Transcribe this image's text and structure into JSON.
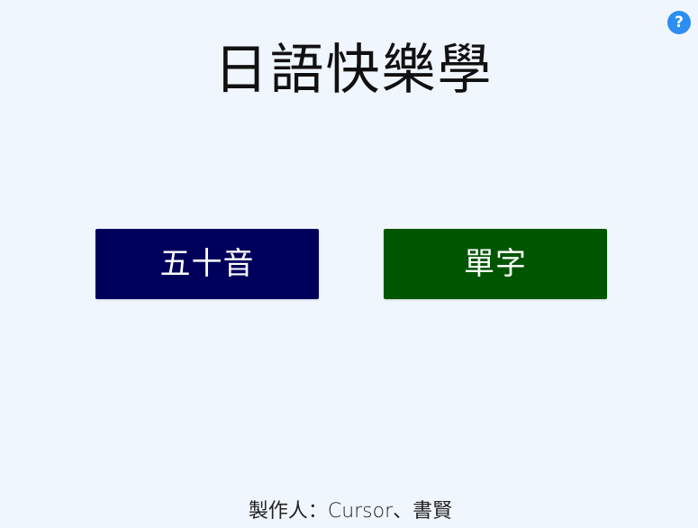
{
  "app": {
    "title": "日語快樂學"
  },
  "help": {
    "label": "?",
    "icon": "help-icon",
    "color": "#2b8ef0"
  },
  "menu": {
    "kana_label": "五十音",
    "kana_color": "#00005c",
    "vocab_label": "單字",
    "vocab_color": "#005600"
  },
  "footer": {
    "credit": "製作人：Cursor、書賢"
  },
  "colors": {
    "background": "#f0f6fe"
  }
}
